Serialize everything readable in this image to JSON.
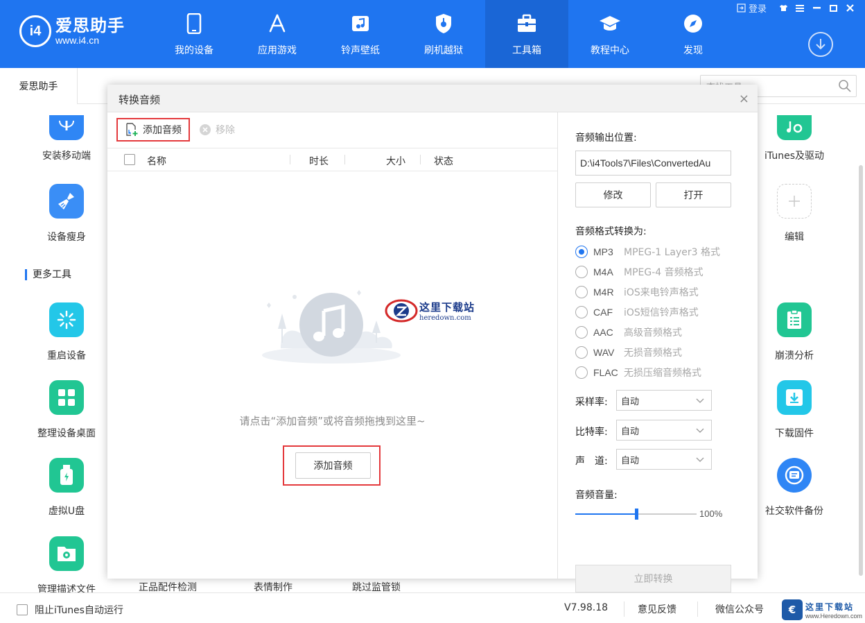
{
  "app": {
    "logo_mark": "i4",
    "logo_name": "爱思助手",
    "logo_url": "www.i4.cn",
    "accent": "#1f75f0",
    "login": "登录"
  },
  "nav": [
    {
      "label": "我的设备",
      "icon": "phone-icon"
    },
    {
      "label": "应用游戏",
      "icon": "app-store-icon"
    },
    {
      "label": "铃声壁纸",
      "icon": "music-note-icon"
    },
    {
      "label": "刷机越狱",
      "icon": "shield-icon"
    },
    {
      "label": "工具箱",
      "icon": "toolbox-icon",
      "active": true
    },
    {
      "label": "教程中心",
      "icon": "graduation-cap-icon"
    },
    {
      "label": "发现",
      "icon": "compass-icon"
    }
  ],
  "tabs": {
    "active": "爱思助手",
    "search_placeholder": "查找工具"
  },
  "tools": {
    "install_mobile": "安装移动端",
    "slim_device": "设备瘦身",
    "more_tools": "更多工具",
    "restart": "重启设备",
    "organize_desktop": "整理设备桌面",
    "virtual_udisk": "虚拟U盘",
    "manage_profiles": "管理描述文件",
    "genuine_check": "正品配件检测",
    "emoji_make": "表情制作",
    "skip_supervision": "跳过监管锁",
    "itunes_driver": "iTunes及驱动",
    "edit": "编辑",
    "crash_analysis": "崩溃分析",
    "download_firmware": "下载固件",
    "social_backup": "社交软件备份"
  },
  "footer": {
    "block_itunes": "阻止iTunes自动运行",
    "version": "V7.98.18",
    "feedback": "意见反馈",
    "wechat": "微信公众号",
    "wm_title": "这里下载站",
    "wm_url": "www.Heredown.com"
  },
  "dialog": {
    "title": "转换音频",
    "add_audio": "添加音频",
    "remove": "移除",
    "columns": {
      "name": "名称",
      "duration": "时长",
      "size": "大小",
      "status": "状态"
    },
    "empty_hint": "请点击“添加音频”或将音频拖拽到这里~",
    "add_audio_center": "添加音频",
    "watermark_title": "这里下载站",
    "watermark_url": "heredown.com",
    "output_label": "音频输出位置:",
    "output_path": "D:\\i4Tools7\\Files\\ConvertedAu",
    "modify": "修改",
    "open": "打开",
    "format_label": "音频格式转换为:",
    "formats": [
      {
        "code": "MP3",
        "desc": "MPEG-1 Layer3 格式",
        "selected": true
      },
      {
        "code": "M4A",
        "desc": "MPEG-4 音频格式"
      },
      {
        "code": "M4R",
        "desc": "iOS来电铃声格式"
      },
      {
        "code": "CAF",
        "desc": "iOS短信铃声格式"
      },
      {
        "code": "AAC",
        "desc": "高级音频格式"
      },
      {
        "code": "WAV",
        "desc": "无损音频格式"
      },
      {
        "code": "FLAC",
        "desc": "无损压缩音频格式"
      }
    ],
    "sample_rate_label": "采样率:",
    "sample_rate": "自动",
    "bit_rate_label": "比特率:",
    "bit_rate": "自动",
    "channel_label": "声　道:",
    "channel": "自动",
    "volume_label": "音频音量:",
    "volume_fraction": 0.5,
    "volume_text": "100%",
    "convert": "立即转换"
  }
}
